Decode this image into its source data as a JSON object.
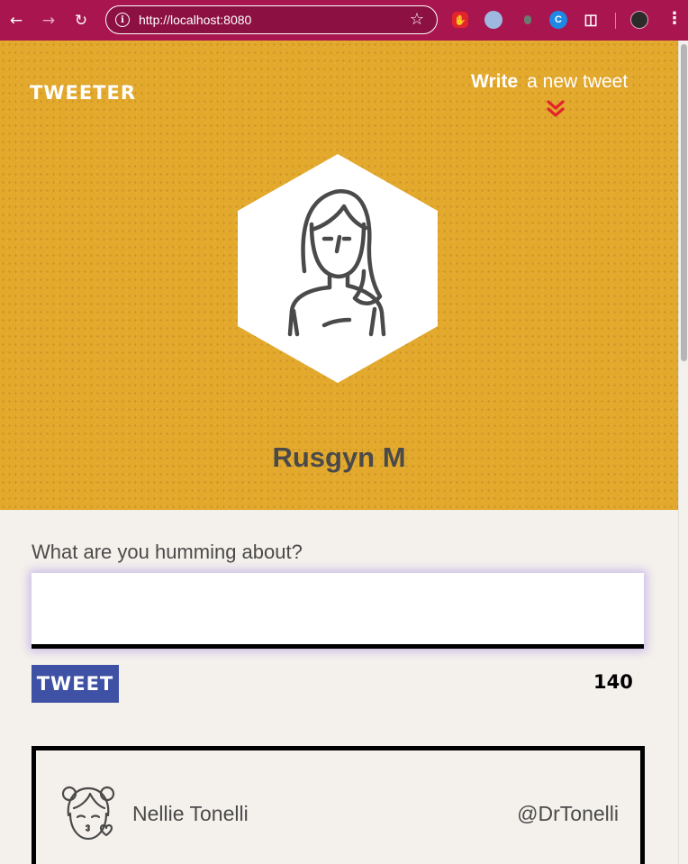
{
  "browser": {
    "url": "http://localhost:8080",
    "theme_color": "#a8154f"
  },
  "header": {
    "logo": "TWEETER",
    "compose_toggle_bold": "Write",
    "compose_toggle_rest": "a new tweet",
    "background_color": "#e3a92d",
    "chevron_color": "#e3242b"
  },
  "profile": {
    "name": "Rusgyn M",
    "avatar_icon": "woman-avatar-icon"
  },
  "composer": {
    "prompt": "What are you humming about?",
    "input_value": "",
    "tweet_button": "TWEET",
    "button_color": "#3f51a5",
    "char_counter": "140"
  },
  "tweets": [
    {
      "name": "Nellie Tonelli",
      "handle": "@DrTonelli",
      "avatar_icon": "girl-kiss-avatar-icon"
    }
  ]
}
